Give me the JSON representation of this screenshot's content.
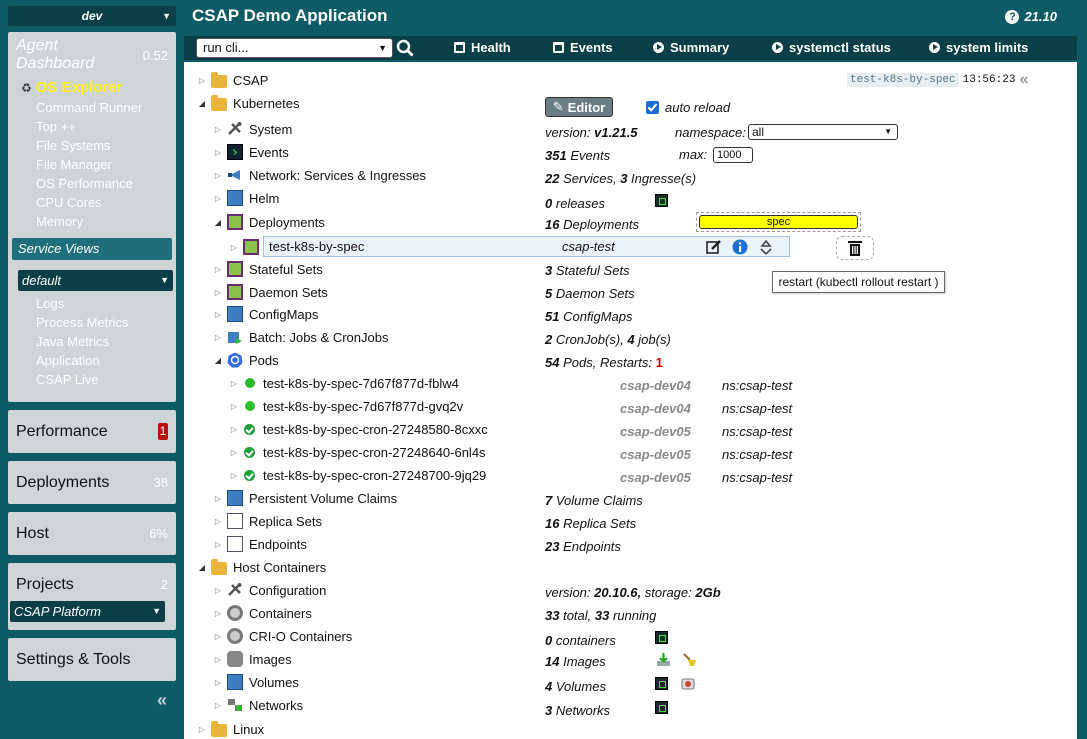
{
  "env": {
    "selected": "dev"
  },
  "sidebar": {
    "agent_title": "Agent Dashboard",
    "agent_version": "0.52",
    "active_item": "OS Explorer",
    "items": [
      "Command Runner",
      "Top ++",
      "File Systems",
      "File Manager",
      "OS Performance",
      "CPU Cores",
      "Memory"
    ],
    "service_views_label": "Service Views",
    "service_select": "default",
    "service_items": [
      "Logs",
      "Process Metrics",
      "Java Metrics",
      "Application",
      "CSAP Live"
    ],
    "panels": {
      "performance": {
        "label": "Performance",
        "badge": "1"
      },
      "deployments": {
        "label": "Deployments",
        "count": "38"
      },
      "host": {
        "label": "Host",
        "count": "6%"
      },
      "projects": {
        "label": "Projects",
        "count": "2",
        "select": "CSAP Platform"
      },
      "settings": {
        "label": "Settings & Tools"
      }
    }
  },
  "header": {
    "title": "CSAP Demo Application",
    "version": "21.10"
  },
  "toolbar": {
    "run_select": "run cli...",
    "buttons": [
      "Health",
      "Events",
      "Summary",
      "systemctl status",
      "system limits"
    ]
  },
  "main": {
    "host_tag": "test-k8s-by-spec",
    "time": "13:56:23",
    "editor_label": "Editor",
    "auto_reload_label": "auto reload",
    "tree": {
      "csap": "CSAP",
      "kubernetes": "Kubernetes",
      "system": "System",
      "events": "Events",
      "network": "Network: Services & Ingresses",
      "helm": "Helm",
      "deployments": "Deployments",
      "selected_deployment": "test-k8s-by-spec",
      "selected_ns": "csap-test",
      "stateful": "Stateful Sets",
      "daemon": "Daemon Sets",
      "configmaps": "ConfigMaps",
      "batch": "Batch: Jobs & CronJobs",
      "pods": "Pods",
      "pvc": "Persistent Volume Claims",
      "replica": "Replica Sets",
      "endpoints": "Endpoints",
      "host_containers": "Host Containers",
      "configuration": "Configuration",
      "containers": "Containers",
      "crio": "CRI-O Containers",
      "images": "Images",
      "volumes": "Volumes",
      "networks": "Networks",
      "linux": "Linux"
    },
    "pods": [
      {
        "name": "test-k8s-by-spec-7d67f877d-fblw4",
        "host": "csap-dev04",
        "ns": "ns:csap-test"
      },
      {
        "name": "test-k8s-by-spec-7d67f877d-gvq2v",
        "host": "csap-dev04",
        "ns": "ns:csap-test"
      },
      {
        "name": "test-k8s-by-spec-cron-27248580-8cxxc",
        "host": "csap-dev05",
        "ns": "ns:csap-test"
      },
      {
        "name": "test-k8s-by-spec-cron-27248640-6nl4s",
        "host": "csap-dev05",
        "ns": "ns:csap-test"
      },
      {
        "name": "test-k8s-by-spec-cron-27248700-9jq29",
        "host": "csap-dev05",
        "ns": "ns:csap-test"
      }
    ],
    "info": {
      "version_label": "version:",
      "k8s_version": "v1.21.5",
      "namespace_label": "namespace:",
      "namespace_value": "all",
      "events_count": "351",
      "events_word": "Events",
      "max_label": "max:",
      "max_value": "1000",
      "services_count": "22",
      "services_word": "Services,",
      "ingress_count": "3",
      "ingress_word": "Ingresse(s)",
      "releases_count": "0",
      "releases_word": "releases",
      "deployments_count": "16",
      "deployments_word": "Deployments",
      "spec_filter": "spec",
      "stateful_count": "3",
      "stateful_word": "Stateful Sets",
      "daemon_count": "5",
      "daemon_word": "Daemon Sets",
      "configmaps_count": "51",
      "configmaps_word": "ConfigMaps",
      "cronjob_count": "2",
      "cronjob_word": "CronJob(s),",
      "job_count": "4",
      "job_word": "job(s)",
      "pods_count": "54",
      "pods_word": "Pods,",
      "restarts_label": "Restarts:",
      "restarts_value": "1",
      "pvc_count": "7",
      "pvc_word": "Volume Claims",
      "replica_count": "16",
      "replica_word": "Replica Sets",
      "endpoints_count": "23",
      "endpoints_word": "Endpoints",
      "docker_version": "20.10.6,",
      "storage_label": "storage:",
      "storage_value": "2Gb",
      "containers_total": "33",
      "containers_total_word": "total,",
      "containers_running": "33",
      "containers_running_word": "running",
      "crio_count": "0",
      "crio_word": "containers",
      "images_count": "14",
      "images_word": "Images",
      "volumes_count": "4",
      "volumes_word": "Volumes",
      "networks_count": "3",
      "networks_word": "Networks"
    },
    "tooltip": "restart (kubectl rollout restart )"
  },
  "colors": {
    "brand": "#0d5b66",
    "accent_yellow": "#ffef1a",
    "badge_red": "#b81313",
    "selected_row": "#e9f3fc"
  }
}
